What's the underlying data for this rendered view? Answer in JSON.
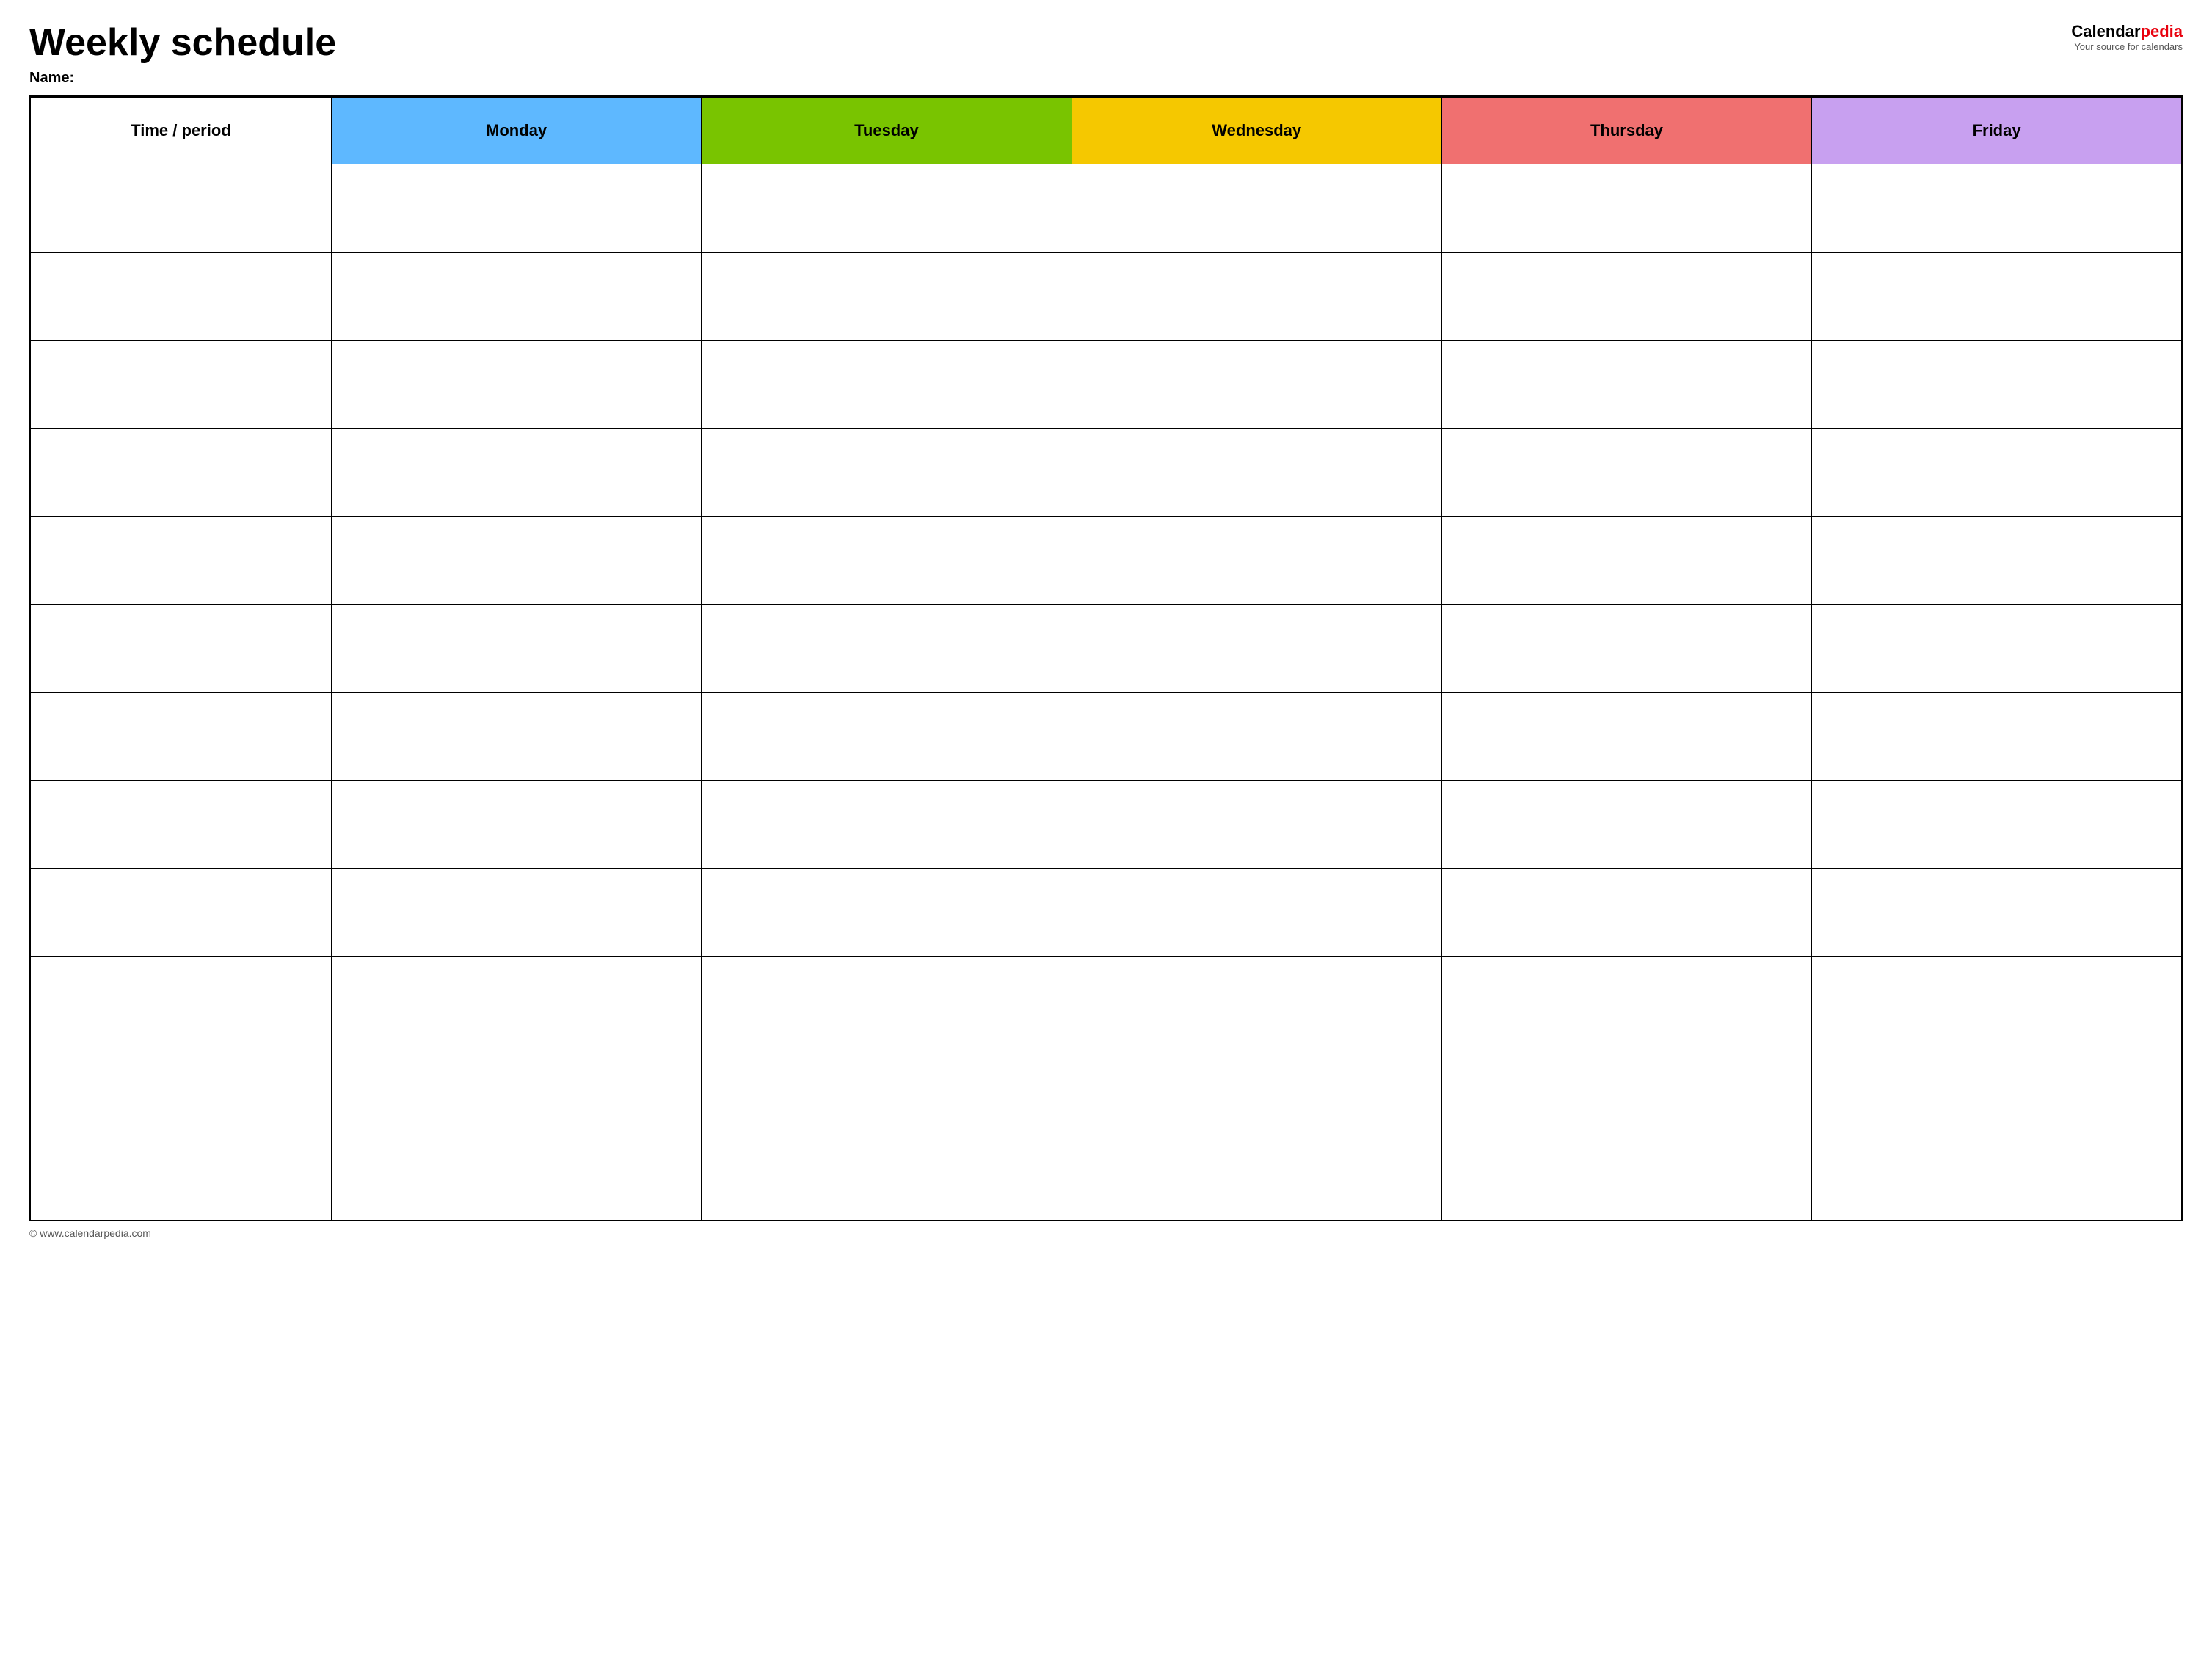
{
  "header": {
    "title": "Weekly schedule",
    "name_label": "Name:",
    "logo_calendar": "Calendar",
    "logo_pedia": "pedia",
    "logo_tagline": "Your source for calendars"
  },
  "table": {
    "columns": [
      {
        "id": "time",
        "label": "Time / period",
        "color": "#ffffff"
      },
      {
        "id": "monday",
        "label": "Monday",
        "color": "#5eb8ff"
      },
      {
        "id": "tuesday",
        "label": "Tuesday",
        "color": "#79c400"
      },
      {
        "id": "wednesday",
        "label": "Wednesday",
        "color": "#f5c800"
      },
      {
        "id": "thursday",
        "label": "Thursday",
        "color": "#f07070"
      },
      {
        "id": "friday",
        "label": "Friday",
        "color": "#c8a0f0"
      }
    ],
    "row_count": 12
  },
  "footer": {
    "copyright": "© www.calendarpedia.com"
  }
}
